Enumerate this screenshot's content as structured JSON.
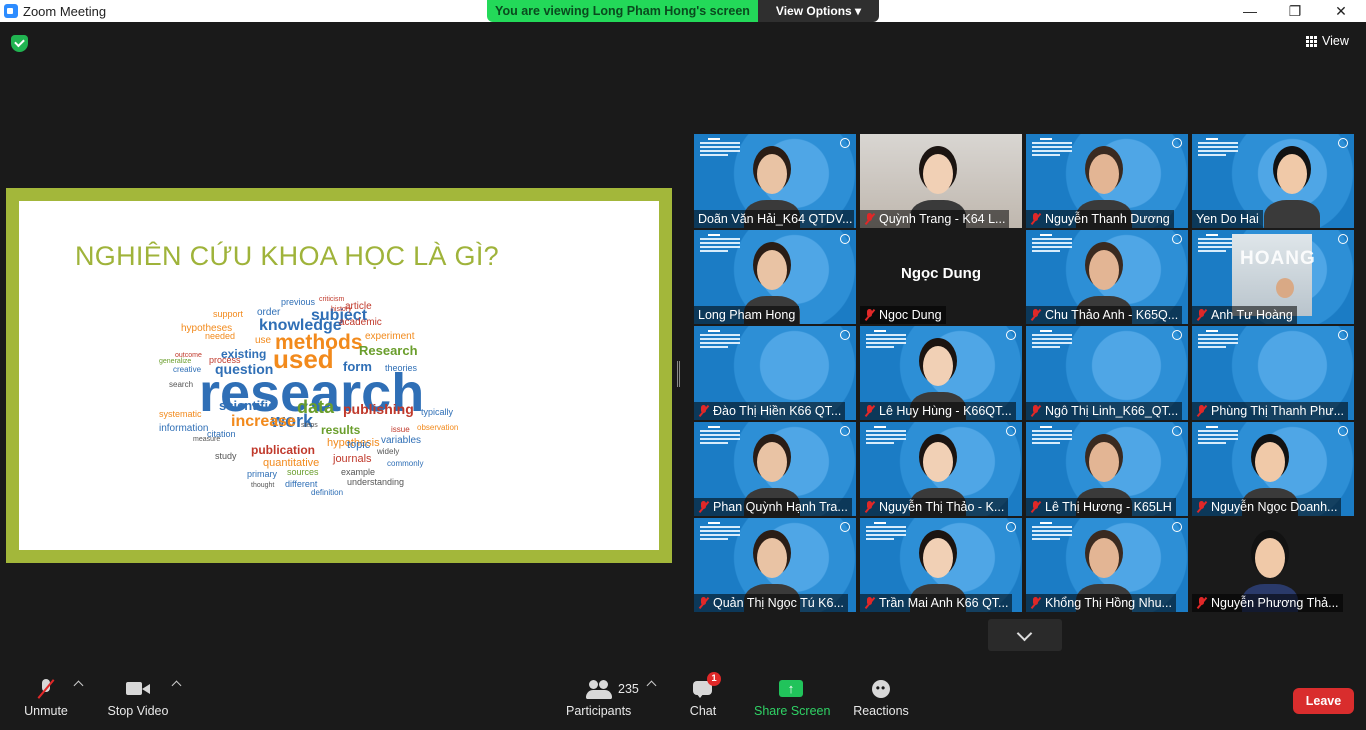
{
  "window": {
    "title": "Zoom Meeting",
    "minimize": "—",
    "maximize": "❐",
    "close": "✕"
  },
  "banner": {
    "viewing": "You are viewing Long Pham Hong's screen",
    "view_options": "View Options ▾"
  },
  "top_right": {
    "view_label": "View"
  },
  "slide": {
    "title": "NGHIÊN CỨU KHOA HỌC LÀ GÌ?",
    "words": [
      {
        "t": "research",
        "c": "#2f6fb6",
        "s": 54
      },
      {
        "t": "used",
        "c": "#f28a1c",
        "s": 26
      },
      {
        "t": "methods",
        "c": "#f28a1c",
        "s": 21
      },
      {
        "t": "knowledge",
        "c": "#2f6fb6",
        "s": 16
      },
      {
        "t": "subject",
        "c": "#2f6fb6",
        "s": 16
      },
      {
        "t": "work",
        "c": "#2f6fb6",
        "s": 18
      },
      {
        "t": "data",
        "c": "#6a9e2c",
        "s": 18
      },
      {
        "t": "increase",
        "c": "#f28a1c",
        "s": 16
      },
      {
        "t": "question",
        "c": "#2f6fb6",
        "s": 14
      },
      {
        "t": "publishing",
        "c": "#c0392b",
        "s": 14
      },
      {
        "t": "Research",
        "c": "#6a9e2c",
        "s": 13
      },
      {
        "t": "form",
        "c": "#2f6fb6",
        "s": 13
      },
      {
        "t": "existing",
        "c": "#2f6fb6",
        "s": 12
      },
      {
        "t": "scientific",
        "c": "#2f6fb6",
        "s": 13
      },
      {
        "t": "results",
        "c": "#6a9e2c",
        "s": 12
      },
      {
        "t": "hypothesis",
        "c": "#f28a1c",
        "s": 11
      },
      {
        "t": "publication",
        "c": "#c0392b",
        "s": 12
      },
      {
        "t": "quantitative",
        "c": "#f28a1c",
        "s": 11
      },
      {
        "t": "journals",
        "c": "#c0392b",
        "s": 11
      },
      {
        "t": "experiment",
        "c": "#f28a1c",
        "s": 10
      },
      {
        "t": "academic",
        "c": "#c0392b",
        "s": 10
      },
      {
        "t": "article",
        "c": "#c0392b",
        "s": 10
      },
      {
        "t": "theories",
        "c": "#2f6fb6",
        "s": 9
      },
      {
        "t": "topic",
        "c": "#2f6fb6",
        "s": 11
      },
      {
        "t": "variables",
        "c": "#2f6fb6",
        "s": 10
      },
      {
        "t": "information",
        "c": "#2f6fb6",
        "s": 10
      },
      {
        "t": "citation",
        "c": "#2f6fb6",
        "s": 9
      },
      {
        "t": "systematic",
        "c": "#f28a1c",
        "s": 9
      },
      {
        "t": "hypotheses",
        "c": "#f28a1c",
        "s": 10
      },
      {
        "t": "support",
        "c": "#f28a1c",
        "s": 9
      },
      {
        "t": "order",
        "c": "#2f6fb6",
        "s": 10
      },
      {
        "t": "previous",
        "c": "#2f6fb6",
        "s": 9
      },
      {
        "t": "needed",
        "c": "#f28a1c",
        "s": 9
      },
      {
        "t": "use",
        "c": "#f28a1c",
        "s": 10
      },
      {
        "t": "process",
        "c": "#c0392b",
        "s": 9
      },
      {
        "t": "understanding",
        "c": "#555555",
        "s": 9
      },
      {
        "t": "sources",
        "c": "#6a9e2c",
        "s": 9
      },
      {
        "t": "different",
        "c": "#2f6fb6",
        "s": 9
      },
      {
        "t": "example",
        "c": "#555555",
        "s": 9
      },
      {
        "t": "typically",
        "c": "#2f6fb6",
        "s": 9
      },
      {
        "t": "observation",
        "c": "#f28a1c",
        "s": 8
      },
      {
        "t": "issue",
        "c": "#c0392b",
        "s": 8
      },
      {
        "t": "study",
        "c": "#555555",
        "s": 9
      },
      {
        "t": "primary",
        "c": "#2f6fb6",
        "s": 9
      },
      {
        "t": "creative",
        "c": "#2f6fb6",
        "s": 8
      },
      {
        "t": "search",
        "c": "#555555",
        "s": 8
      },
      {
        "t": "criticism",
        "c": "#c0392b",
        "s": 7
      },
      {
        "t": "history",
        "c": "#c0392b",
        "s": 7
      },
      {
        "t": "widely",
        "c": "#555555",
        "s": 8
      },
      {
        "t": "commonly",
        "c": "#2f6fb6",
        "s": 8
      },
      {
        "t": "definition",
        "c": "#2f6fb6",
        "s": 8
      },
      {
        "t": "steps",
        "c": "#555555",
        "s": 7
      },
      {
        "t": "measure",
        "c": "#555555",
        "s": 7
      },
      {
        "t": "outcome",
        "c": "#c0392b",
        "s": 7
      },
      {
        "t": "generalize",
        "c": "#6a9e2c",
        "s": 7
      },
      {
        "t": "thought",
        "c": "#555555",
        "s": 7
      }
    ]
  },
  "participants": [
    {
      "name": "Doãn Văn Hải_K64 QTDV...",
      "muted": false,
      "kind": "video"
    },
    {
      "name": "Quỳnh Trang - K64 L...",
      "muted": true,
      "kind": "room"
    },
    {
      "name": "Nguyễn Thanh Dương",
      "muted": true,
      "kind": "video"
    },
    {
      "name": "Yen Do Hai",
      "muted": false,
      "kind": "video"
    },
    {
      "name": "Long Pham Hong",
      "muted": false,
      "kind": "video"
    },
    {
      "name": "Ngoc Dung",
      "muted": true,
      "kind": "noface",
      "display": "Ngọc Dung"
    },
    {
      "name": "Chu Thảo Anh - K65Q...",
      "muted": true,
      "kind": "video"
    },
    {
      "name": "Anh Tư Hoàng",
      "muted": true,
      "kind": "photo",
      "photo_text": "HOANG"
    },
    {
      "name": "Đào Thị Hiền K66 QT...",
      "muted": true,
      "kind": "wall"
    },
    {
      "name": "Lê Huy Hùng - K66QT...",
      "muted": true,
      "kind": "video"
    },
    {
      "name": "Ngô Thị Linh_K66_QT...",
      "muted": true,
      "kind": "wall"
    },
    {
      "name": "Phùng Thị Thanh Phư...",
      "muted": true,
      "kind": "wall"
    },
    {
      "name": "Phan Quỳnh Hạnh Tra...",
      "muted": true,
      "kind": "video"
    },
    {
      "name": "Nguyễn Thị Thảo - K...",
      "muted": true,
      "kind": "video"
    },
    {
      "name": "Lê Thị Hương - K65LH",
      "muted": true,
      "kind": "video"
    },
    {
      "name": "Nguyễn Ngọc Doanh...",
      "muted": true,
      "kind": "video"
    },
    {
      "name": "Quản Thị Ngọc Tú K6...",
      "muted": true,
      "kind": "video"
    },
    {
      "name": "Trần Mai Anh K66 QT...",
      "muted": true,
      "kind": "video"
    },
    {
      "name": "Khổng Thị Hồng Nhu...",
      "muted": true,
      "kind": "video"
    },
    {
      "name": "Nguyễn Phương Thả...",
      "muted": true,
      "kind": "dark"
    }
  ],
  "toolbar": {
    "unmute": "Unmute",
    "stop_video": "Stop Video",
    "participants": "Participants",
    "participants_count": "235",
    "chat": "Chat",
    "chat_badge": "1",
    "share_screen": "Share Screen",
    "reactions": "Reactions",
    "leave": "Leave"
  },
  "colors": {
    "share_green": "#23d959",
    "active_speaker": "#f5e44d",
    "leave_red": "#d92d2d",
    "slide_frame": "#a3b73a"
  }
}
